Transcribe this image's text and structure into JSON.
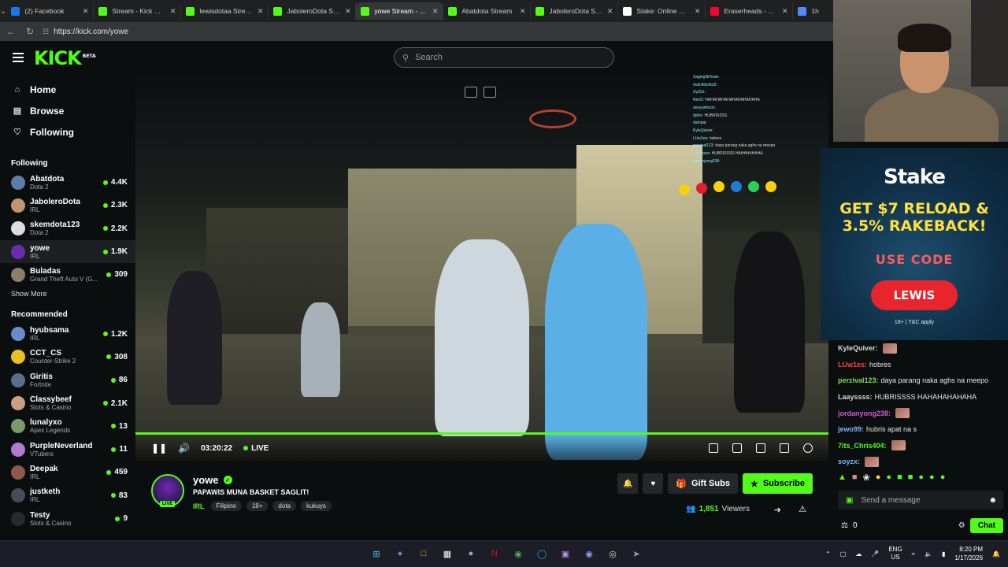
{
  "browser": {
    "tabs": [
      {
        "label": "(2) Facebook",
        "color": "#1877f2"
      },
      {
        "label": "Stream - Kick Dashboard",
        "color": "#53fc18"
      },
      {
        "label": "lewisdotaa Stream",
        "color": "#53fc18"
      },
      {
        "label": "JaboleroDota Stream",
        "color": "#53fc18"
      },
      {
        "label": "yowe Stream - Watch",
        "color": "#53fc18",
        "active": true
      },
      {
        "label": "Abatdota Stream",
        "color": "#53fc18"
      },
      {
        "label": "JaboleroDota Stream",
        "color": "#53fc18"
      },
      {
        "label": "Stake: Online Casino",
        "color": "#ffffff"
      },
      {
        "label": "Eraserheads - Ang H",
        "color": "#ff0033"
      },
      {
        "label": "1h",
        "color": "#4d8bf5"
      }
    ],
    "url": "https://kick.com/yowe"
  },
  "header": {
    "logo": "KICK",
    "logo_badge": "BETA",
    "search_placeholder": "Search"
  },
  "sidebar": {
    "nav": [
      {
        "label": "Home",
        "icon": "home-icon"
      },
      {
        "label": "Browse",
        "icon": "browse-icon"
      },
      {
        "label": "Following",
        "icon": "heart-icon"
      }
    ],
    "following_title": "Following",
    "following": [
      {
        "name": "Abatdota",
        "category": "Dota 2",
        "viewers": "4.4K",
        "color": "#5b7fa8"
      },
      {
        "name": "JaboleroDota",
        "category": "IRL",
        "viewers": "2.3K",
        "color": "#c29472"
      },
      {
        "name": "skemdota123",
        "category": "Dota 2",
        "viewers": "2.2K",
        "color": "#dddddd"
      },
      {
        "name": "yowe",
        "category": "IRL",
        "viewers": "1.9K",
        "color": "#6b2bb0",
        "selected": true
      },
      {
        "name": "Buladas",
        "category": "Grand Theft Auto V (G...",
        "viewers": "309",
        "color": "#8a7f6a"
      }
    ],
    "show_more": "Show More",
    "recommended_title": "Recommended",
    "recommended": [
      {
        "name": "hyubsama",
        "category": "IRL",
        "viewers": "1.2K",
        "color": "#6a8ac8"
      },
      {
        "name": "CCT_CS",
        "category": "Counter-Strike 2",
        "viewers": "308",
        "color": "#e8c020"
      },
      {
        "name": "Giritis",
        "category": "Fortnite",
        "viewers": "86",
        "color": "#5a6e8a"
      },
      {
        "name": "Classybeef",
        "category": "Slots & Casino",
        "viewers": "2.1K",
        "color": "#c9a080"
      },
      {
        "name": "lunalyxo",
        "category": "Apex Legends",
        "viewers": "13",
        "color": "#7a9a6a"
      },
      {
        "name": "PurpleNeverland",
        "category": "VTubers",
        "viewers": "11",
        "color": "#b07ad0"
      },
      {
        "name": "Deepak",
        "category": "IRL",
        "viewers": "459",
        "color": "#8a5a4a"
      },
      {
        "name": "justketh",
        "category": "IRL",
        "viewers": "83",
        "color": "#4a4a5a"
      },
      {
        "name": "Testy",
        "category": "Slots & Casino",
        "viewers": "9",
        "color": "#2a2a2a"
      }
    ]
  },
  "player": {
    "time": "03:20:22",
    "live_label": "LIVE",
    "overlay_chat": [
      {
        "user": "SagingNiYowe:",
        "text": ""
      },
      {
        "user": "mainitdyoko2:",
        "text": ""
      },
      {
        "user": "XyzDz:",
        "text": ""
      },
      {
        "user": "NeriS:",
        "text": "HAHAHAHAHAHAHAHAHAHA"
      },
      {
        "user": "seyyywhooo:",
        "text": ""
      },
      {
        "user": "dyiko:",
        "text": "HUBRISSSS"
      },
      {
        "user": "dampai:",
        "text": ""
      },
      {
        "user": "KyleQuiver:",
        "text": ""
      },
      {
        "user": "LUw1es:",
        "text": "hobres"
      },
      {
        "user": "perzival123:",
        "text": "daya parang naka aghs na meepo"
      },
      {
        "user": "Laayssss:",
        "text": "HUBRISSSS HAHAHAHAHA"
      },
      {
        "user": "jordanyong238:",
        "text": ""
      }
    ]
  },
  "stream": {
    "name": "yowe",
    "title": "PAPAWIS MUNA BASKET SAGLIT!",
    "category": "IRL",
    "tags": [
      "Filipino",
      "18+",
      "dota",
      "kukuys"
    ],
    "live_badge": "LIVE",
    "gift_label": "Gift Subs",
    "subscribe_label": "Subscribe",
    "viewers_count": "1,851",
    "viewers_label": "Viewers"
  },
  "ad": {
    "brand": "Stake",
    "line1": "GET $7 RELOAD &",
    "line2": "3.5% RAKEBACK!",
    "code_label": "USE CODE",
    "code": "LEWIS",
    "terms": "18+ | T&C apply"
  },
  "chat": {
    "messages": [
      {
        "user": "KyleQuiver:",
        "text": "",
        "color": "#d8d8d8",
        "emote": true
      },
      {
        "user": "LUw1es:",
        "text": "hobres",
        "color": "#ff4040",
        "emote": false
      },
      {
        "user": "perzival123:",
        "text": "daya parang naka aghs na meepo",
        "color": "#7ddc5a",
        "emote": false
      },
      {
        "user": "Laayssss:",
        "text": "HUBRISSSS HAHAHAHAHAHA",
        "color": "#d8d8d8",
        "emote": false
      },
      {
        "user": "jordanyong238:",
        "text": "",
        "color": "#d05ad0",
        "emote": true
      },
      {
        "user": "jewo99:",
        "text": "hubris apat na s",
        "color": "#7ab8ff",
        "emote": false
      },
      {
        "user": "7its_Chris404:",
        "text": "",
        "color": "#53fc18",
        "emote": true
      },
      {
        "user": "soyzx:",
        "text": "",
        "color": "#7ab8ff",
        "emote": true
      }
    ],
    "input_placeholder": "Send a message",
    "points": "0",
    "chat_button": "Chat"
  },
  "taskbar": {
    "lang_top": "ENG",
    "lang_bottom": "US",
    "time": "8:20 PM",
    "date": "1/17/2026"
  }
}
